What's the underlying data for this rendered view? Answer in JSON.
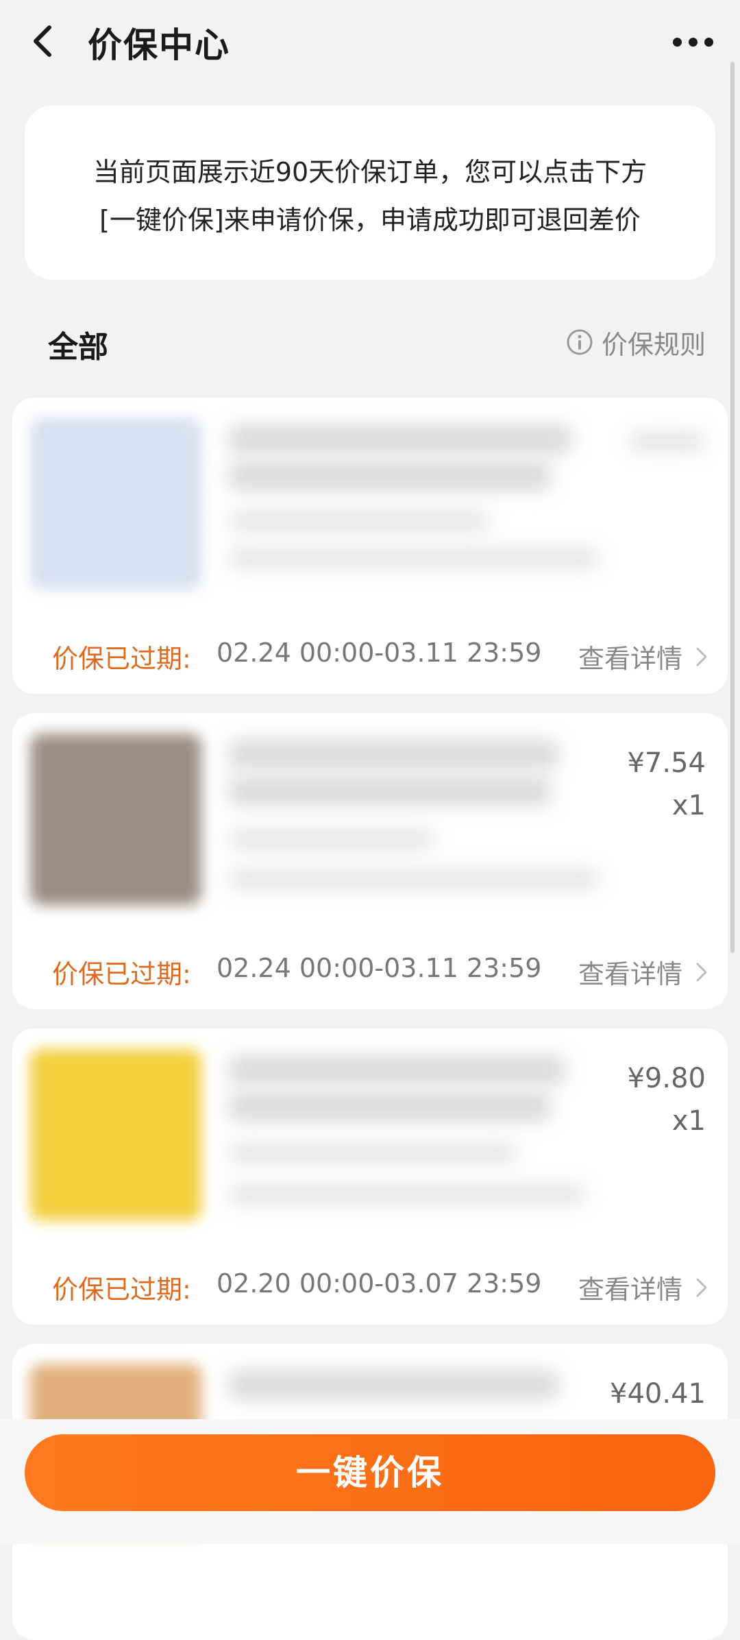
{
  "header": {
    "title": "价保中心",
    "back_icon": "back-icon",
    "more_icon": "more-icon"
  },
  "notice": {
    "line1": "当前页面展示近90天价保订单，您可以点击下方",
    "line2": "[一键价保]来申请价保，申请成功即可退回差价"
  },
  "section": {
    "title": "全部",
    "rules_label": "价保规则",
    "rules_icon": "info-icon"
  },
  "orders": [
    {
      "price": "",
      "qty": "",
      "status_label": "价保已过期:",
      "period": "02.24 00:00-03.11 23:59",
      "details_label": "查看详情",
      "thumb_color": "#d8dff0"
    },
    {
      "price": "¥7.54",
      "qty": "x1",
      "status_label": "价保已过期:",
      "period": "02.24 00:00-03.11 23:59",
      "details_label": "查看详情",
      "thumb_color": "#9a8f84"
    },
    {
      "price": "¥9.80",
      "qty": "x1",
      "status_label": "价保已过期:",
      "period": "02.20 00:00-03.07 23:59",
      "details_label": "查看详情",
      "thumb_color": "#f2cf3f"
    },
    {
      "price": "¥40.41",
      "qty": "",
      "status_label": "",
      "period": "",
      "details_label": "",
      "thumb_color": "#e0b07a"
    }
  ],
  "bottom": {
    "button_label": "一键价保"
  },
  "colors": {
    "accent": "#f76c14",
    "status_orange": "#e06b1f",
    "background": "#f2f2f2"
  }
}
